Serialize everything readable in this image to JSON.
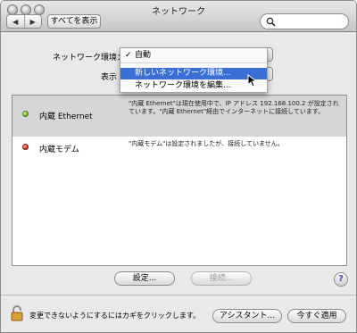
{
  "window": {
    "title": "ネットワーク"
  },
  "toolbar": {
    "show_all_label": "すべてを表示",
    "search_placeholder": ""
  },
  "location": {
    "label": "ネットワーク環境：",
    "menu": {
      "items": [
        {
          "label": "自動",
          "checked": true
        },
        {
          "label": "新しいネットワーク環境...",
          "highlighted": true
        },
        {
          "label": "ネットワーク環境を編集..."
        }
      ]
    }
  },
  "show": {
    "label": "表示"
  },
  "services": [
    {
      "name": "内蔵 Ethernet",
      "status": "green",
      "description": "\"内蔵 Ethernet\"は現在使用中で、IP アドレス 192.168.100.2 が設定されています。\"内蔵 Ethernet\"経由でインターネットに接続しています。"
    },
    {
      "name": "内蔵モデム",
      "status": "red",
      "description": "\"内蔵モデム\"は設定されましたが、接続していません。"
    }
  ],
  "buttons": {
    "configure": "設定...",
    "connect": "接続...",
    "help": "?",
    "assistant": "アシスタント...",
    "apply": "今すぐ適用"
  },
  "lock": {
    "text": "変更できないようにするにはカギをクリックします。"
  },
  "colors": {
    "menu_highlight": "#3a6fd6",
    "selected_row": "#d6d6d6"
  }
}
